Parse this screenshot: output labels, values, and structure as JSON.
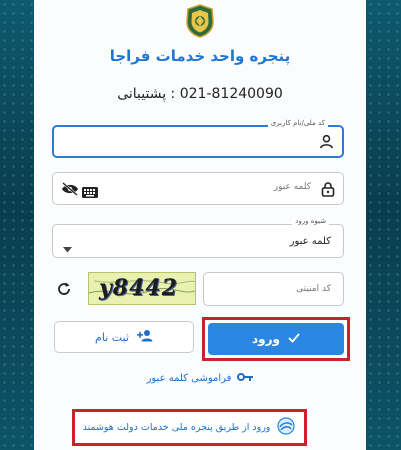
{
  "header": {
    "title": "پنجره واحد خدمات فراجا",
    "support": "021-81240090 : پشتیبانی"
  },
  "form": {
    "national_id_label": "کد ملی/نام کاربری",
    "password_placeholder": "کلمه عبور",
    "method_label": "شیوه ورود",
    "method_value": "کلمه عبور",
    "captcha_placeholder": "کد امنیتی",
    "captcha_text": "y8442"
  },
  "buttons": {
    "login": "ورود",
    "register": "ثبت نام",
    "forgot": "فراموشی کلمه عبور",
    "gov_login": "ورود از طریق پنجره ملی خدمات دولت هوشمند"
  },
  "colors": {
    "accent": "#2a86e0",
    "highlight": "#c8232c",
    "link": "#1e6fc8"
  },
  "icons": {
    "user": "user-icon",
    "eye_off": "eye-off-icon",
    "keyboard": "keyboard-icon",
    "lock": "lock-icon",
    "chevron": "chevron-down-icon",
    "refresh": "refresh-icon",
    "check": "check-icon",
    "add_user": "add-user-icon",
    "key": "key-icon",
    "gov": "gov-logo-icon"
  }
}
